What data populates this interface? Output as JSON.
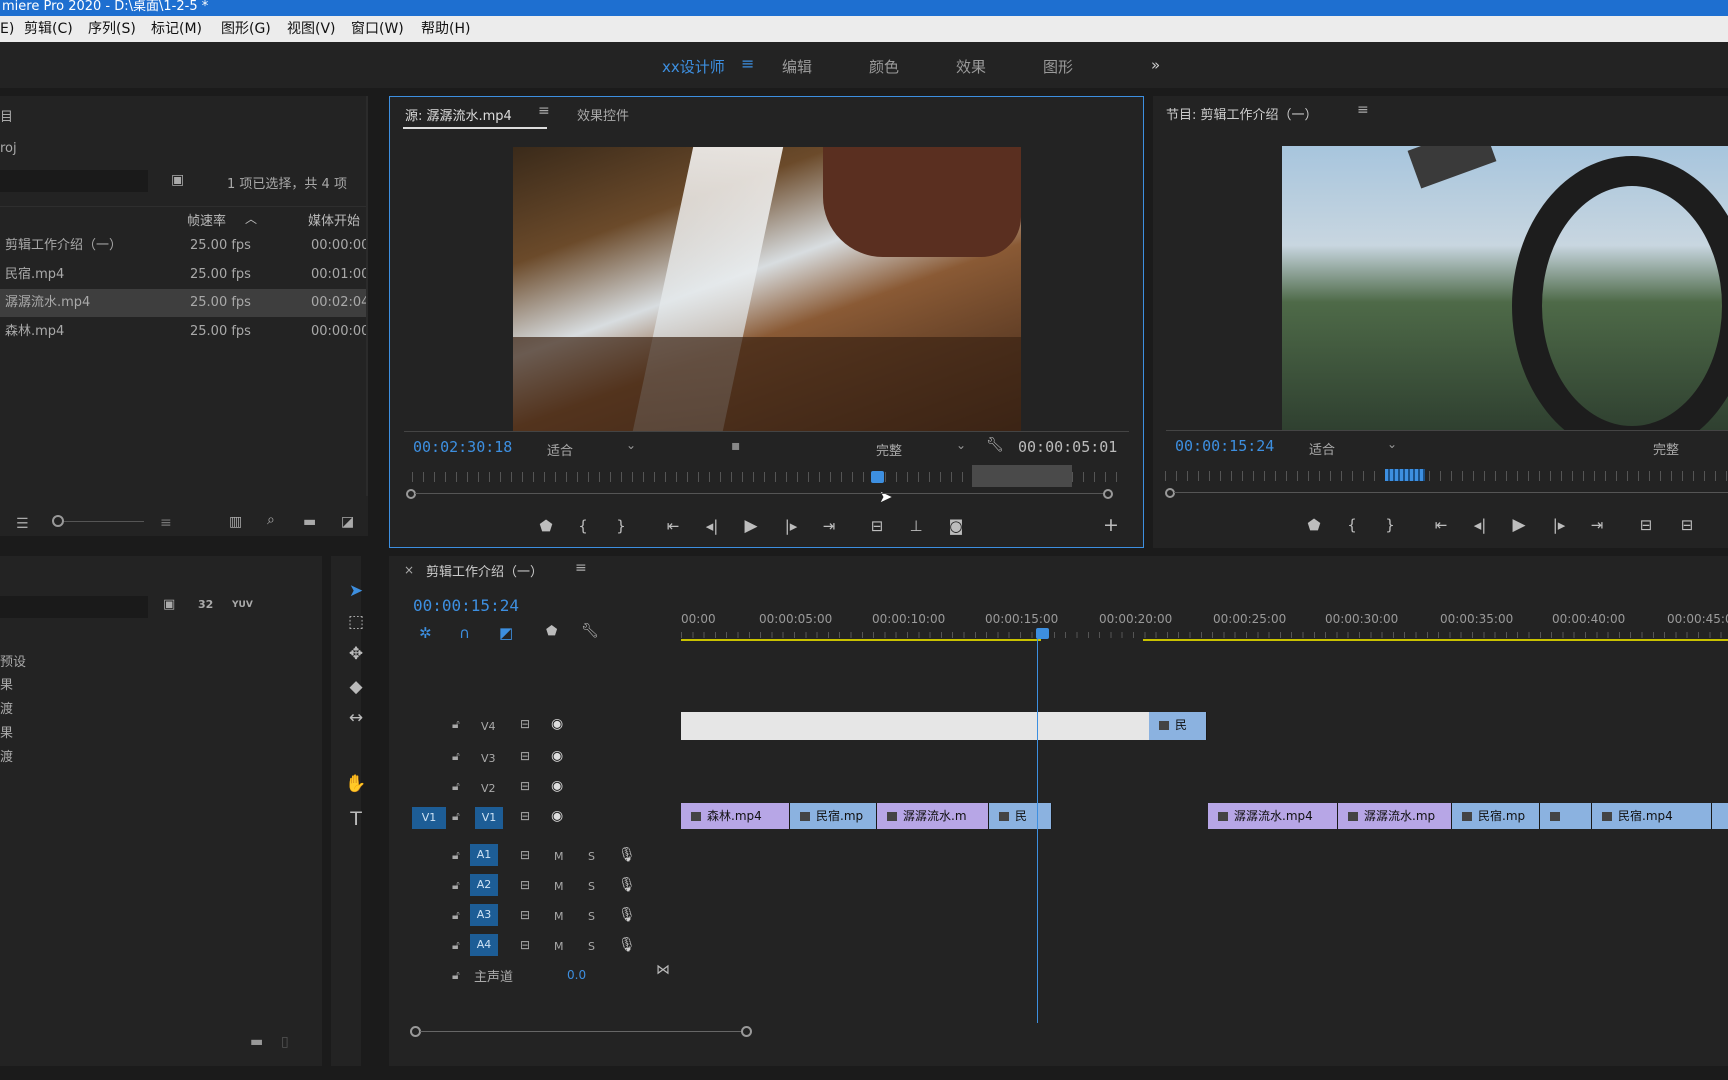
{
  "window": {
    "title": "miere Pro 2020 - D:\\桌面\\1-2-5 *"
  },
  "menu": [
    "E)",
    "剪辑(C)",
    "序列(S)",
    "标记(M)",
    "图形(G)",
    "视图(V)",
    "窗口(W)",
    "帮助(H)"
  ],
  "workspaces": {
    "active": "xx设计师",
    "items": [
      "编辑",
      "颜色",
      "效果",
      "图形"
    ],
    "more": "»"
  },
  "project": {
    "title": "目",
    "name": "roj",
    "selection": "1 项已选择，共 4 项",
    "columns": {
      "framerate": "帧速率",
      "media_start": "媒体开始"
    },
    "items": [
      {
        "name": "剪辑工作介绍（一）",
        "fps": "25.00 fps",
        "start": "00:00:00:"
      },
      {
        "name": "民宿.mp4",
        "fps": "25.00 fps",
        "start": "00:01:00:"
      },
      {
        "name": "潺潺流水.mp4",
        "fps": "25.00 fps",
        "start": "00:02:04:"
      },
      {
        "name": "森林.mp4",
        "fps": "25.00 fps",
        "start": "00:00:00:"
      }
    ]
  },
  "effects": {
    "items": [
      "预设",
      "果",
      "渡",
      "果",
      "渡"
    ],
    "badges": [
      "32",
      "YUV"
    ]
  },
  "source": {
    "tab_active": "源: 潺潺流水.mp4",
    "tab_inactive": "效果控件",
    "timecode": "00:02:30:18",
    "fit": "适合",
    "quality": "完整",
    "duration": "00:00:05:01",
    "add": "+"
  },
  "program": {
    "title": "节目: 剪辑工作介绍（一）",
    "timecode": "00:00:15:24",
    "fit": "适合",
    "quality": "完整"
  },
  "timeline": {
    "close": "×",
    "title": "剪辑工作介绍（一）",
    "timecode": "00:00:15:24",
    "ruler": [
      "00:00",
      "00:00:05:00",
      "00:00:10:00",
      "00:00:15:00",
      "00:00:20:00",
      "00:00:25:00",
      "00:00:30:00",
      "00:00:35:00",
      "00:00:40:00",
      "00:00:45:0"
    ],
    "video_tracks": [
      "V4",
      "V3",
      "V2",
      "V1"
    ],
    "source_patch": "V1",
    "audio_tracks": [
      "A1",
      "A2",
      "A3",
      "A4"
    ],
    "master": {
      "label": "主声道",
      "value": "0.0"
    },
    "track_m": "M",
    "track_s": "S",
    "v4_clip": "民",
    "v1_clips": [
      "森林.mp4",
      "民宿.mp",
      "潺潺流水.m",
      "民",
      "潺潺流水.mp4",
      "潺潺流水.mp",
      "民宿.mp",
      "",
      "民宿.mp4"
    ]
  },
  "colors": {
    "accent": "#3d8fe0",
    "clip_purple": "#b7a6e6",
    "clip_blue": "#8bb2e0",
    "track_badge": "#1d5d96"
  }
}
